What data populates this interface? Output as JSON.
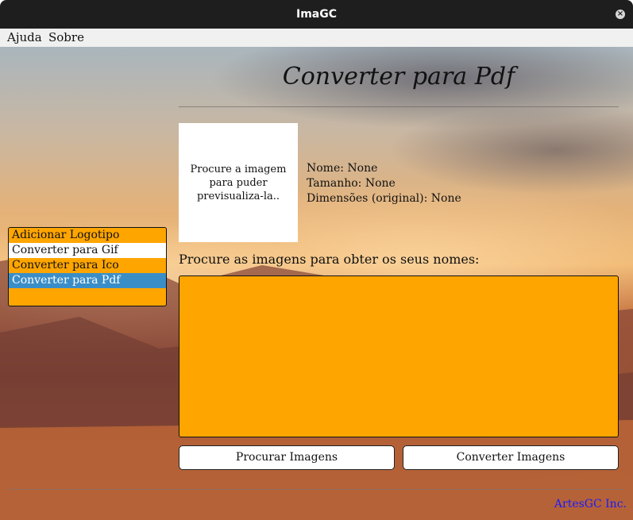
{
  "window": {
    "title": "ImaGC",
    "close_icon": "close-icon"
  },
  "menu": {
    "items": [
      "Ajuda",
      "Sobre"
    ]
  },
  "page": {
    "heading": "Converter para Pdf",
    "preview_text": "Procure a imagem para puder previsualiza-la..",
    "info": {
      "name": "Nome: None",
      "size": "Tamanho: None",
      "dimensions": "Dimensões (original): None"
    },
    "prompt": "Procure as imagens para obter os seus nomes:",
    "buttons": {
      "browse": "Procurar Imagens",
      "convert": "Converter Imagens"
    },
    "footer": "ArtesGC Inc."
  },
  "sidebar": {
    "items": [
      {
        "label": "Adicionar Logotipo",
        "state": "normal"
      },
      {
        "label": "Converter para Gif",
        "state": "alternate"
      },
      {
        "label": "Converter para Ico",
        "state": "normal"
      },
      {
        "label": "Converter para Pdf",
        "state": "selected"
      }
    ]
  },
  "colors": {
    "accent": "#ffa500",
    "selection": "#3a8ec8",
    "titlebar": "#1e1e1e",
    "footer_link": "#1a1aff"
  }
}
